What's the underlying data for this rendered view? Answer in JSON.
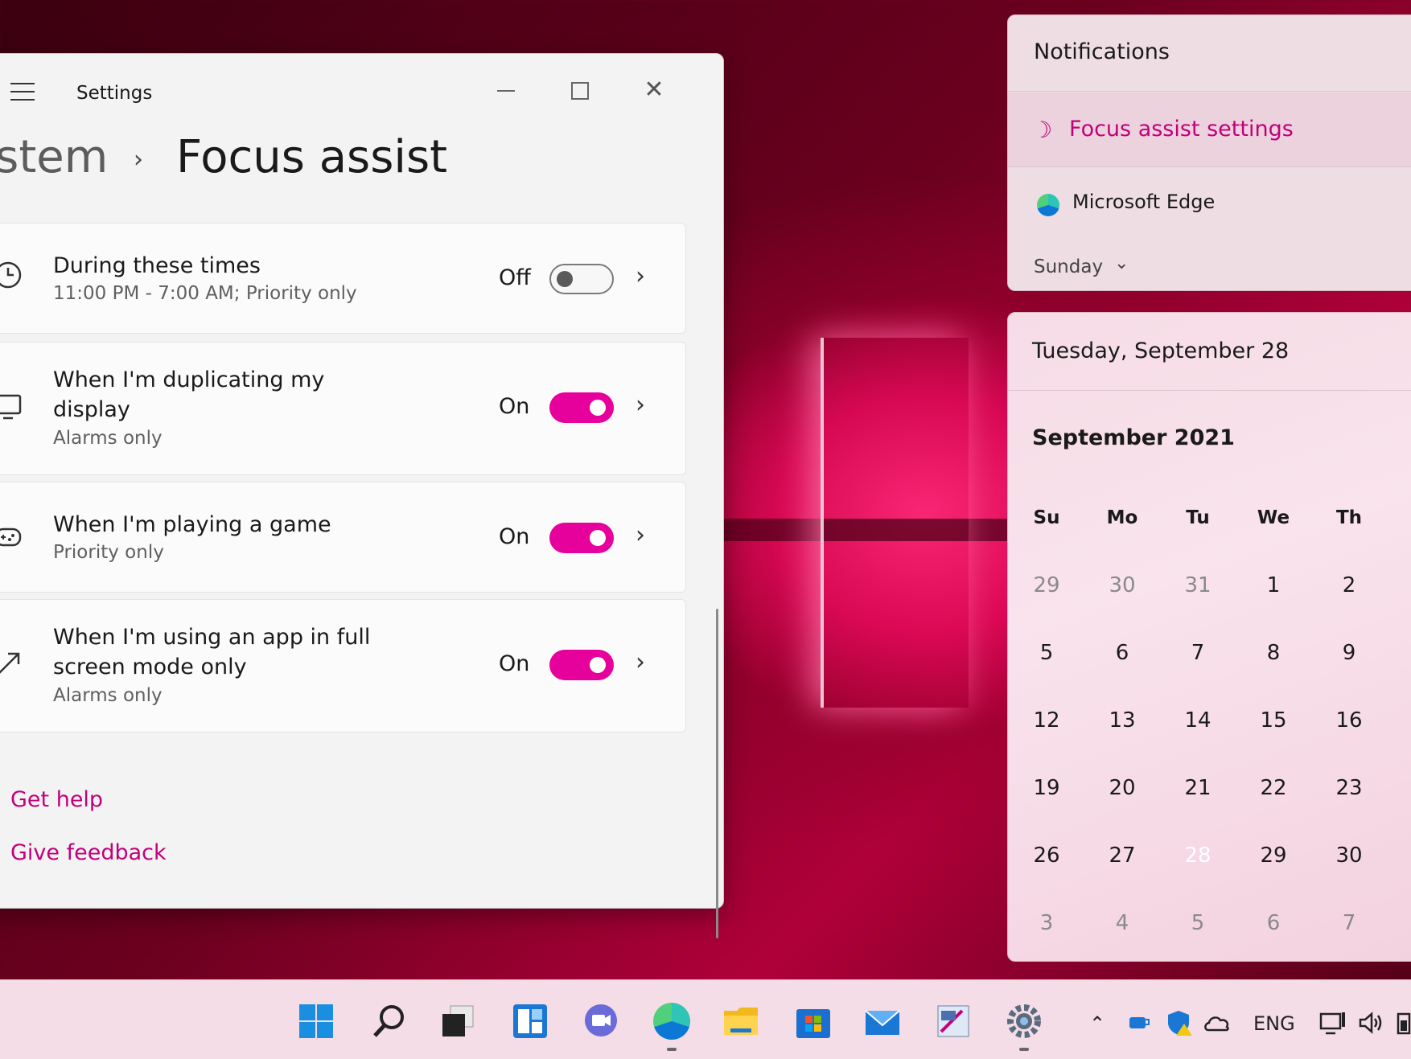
{
  "settings": {
    "app_title": "Settings",
    "breadcrumb_parent": "ystem",
    "breadcrumb_separator": "›",
    "breadcrumb_current": "Focus assist",
    "rows": [
      {
        "title": "During these times",
        "subtitle": "11:00 PM - 7:00 AM; Priority only",
        "state": "Off",
        "icon": "clock-icon"
      },
      {
        "title": "When I'm duplicating my display",
        "subtitle": "Alarms only",
        "state": "On",
        "icon": "monitor-icon"
      },
      {
        "title": "When I'm playing a game",
        "subtitle": "Priority only",
        "state": "On",
        "icon": "gamepad-icon"
      },
      {
        "title": "When I'm using an app in full screen mode only",
        "subtitle": "Alarms only",
        "state": "On",
        "icon": "fullscreen-icon"
      }
    ],
    "get_help": "Get help",
    "give_feedback": "Give feedback"
  },
  "notifications": {
    "header": "Notifications",
    "focus_link": "Focus assist settings",
    "app_name": "Microsoft Edge",
    "day": "Sunday"
  },
  "calendar": {
    "date_header": "Tuesday, September 28",
    "month_label": "September 2021",
    "weekdays": [
      "Su",
      "Mo",
      "Tu",
      "We",
      "Th"
    ],
    "weeks": [
      [
        "29",
        "30",
        "31",
        "1",
        "2"
      ],
      [
        "5",
        "6",
        "7",
        "8",
        "9"
      ],
      [
        "12",
        "13",
        "14",
        "15",
        "16"
      ],
      [
        "19",
        "20",
        "21",
        "22",
        "23"
      ],
      [
        "26",
        "27",
        "28",
        "29",
        "30"
      ],
      [
        "3",
        "4",
        "5",
        "6",
        "7"
      ]
    ],
    "today": "28"
  },
  "taskbar": {
    "apps": [
      "start-icon",
      "search-icon",
      "task-view-icon",
      "widgets-icon",
      "chat-icon",
      "edge-icon",
      "file-explorer-icon",
      "store-icon",
      "mail-icon",
      "paint-icon",
      "settings-icon"
    ],
    "language": "ENG"
  },
  "colors": {
    "accent": "#e6009c",
    "link": "#c2007c"
  }
}
